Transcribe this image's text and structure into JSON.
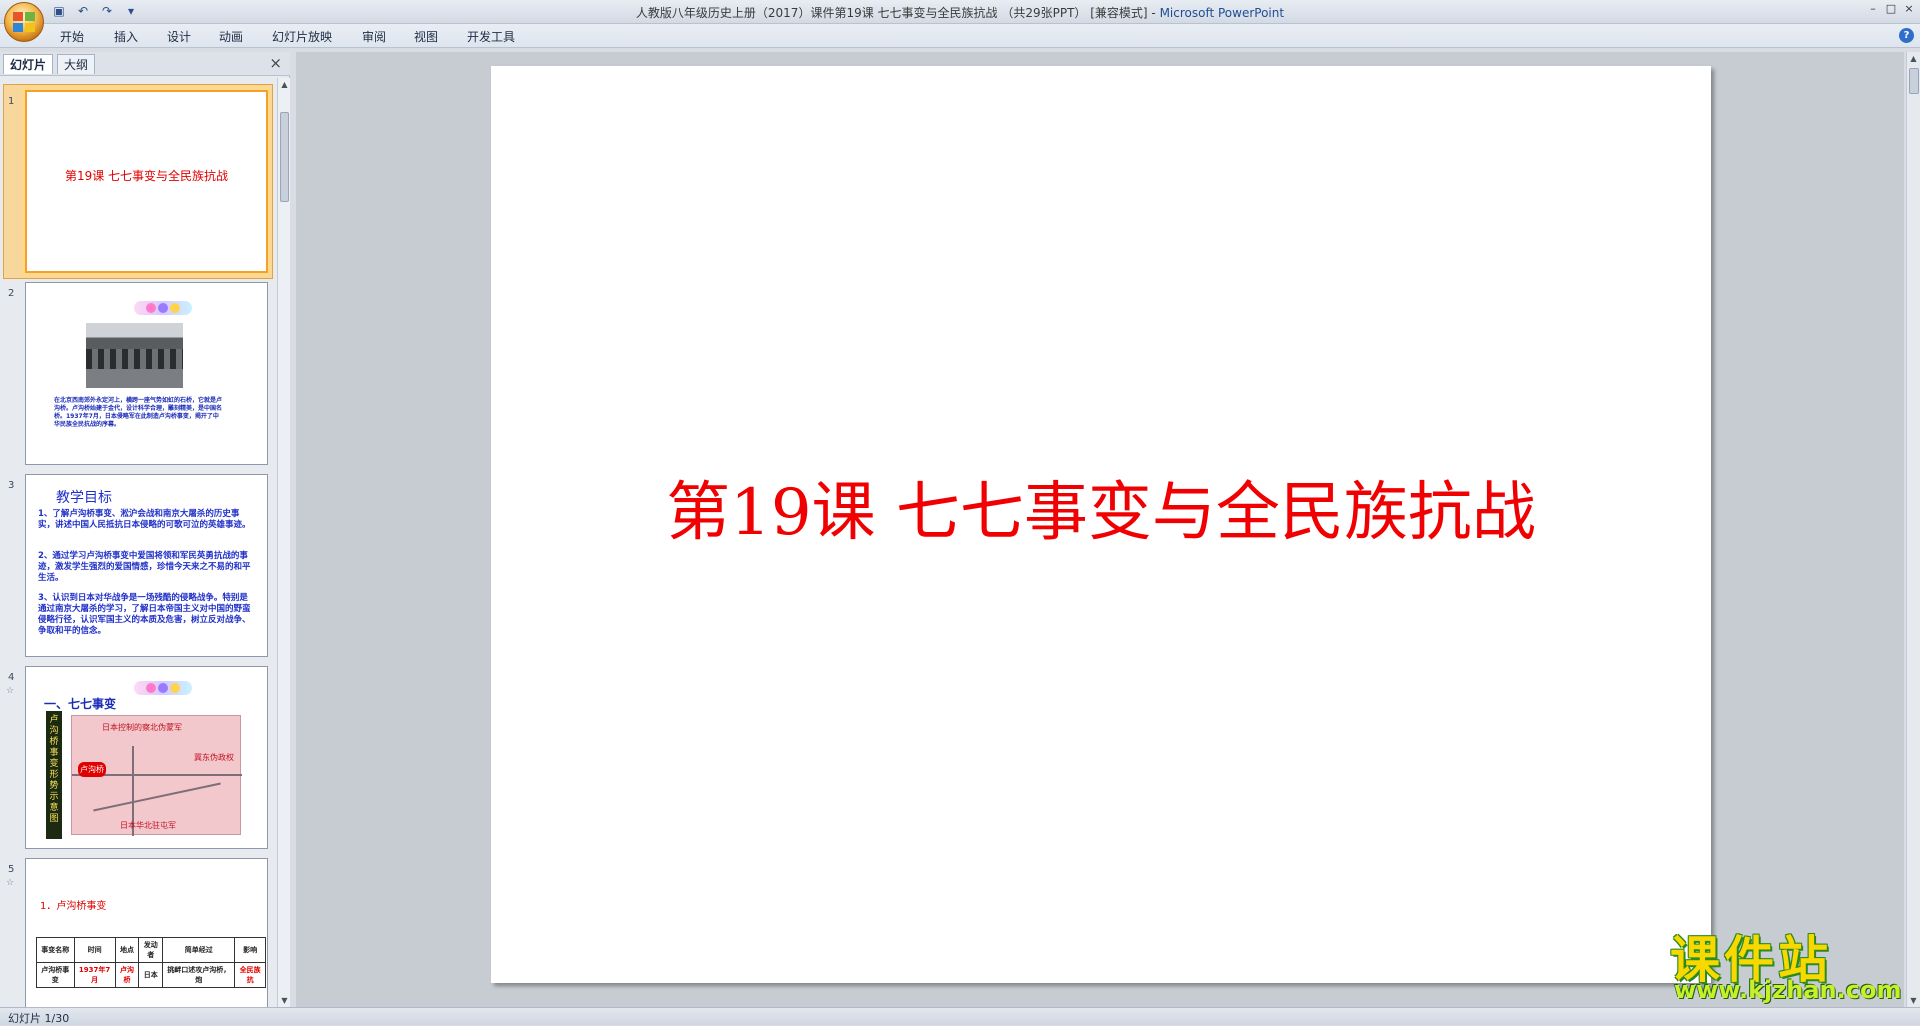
{
  "window": {
    "title": "人教版八年级历史上册（2017）课件第19课 七七事变与全民族抗战 （共29张PPT） [兼容模式]",
    "separator": " - ",
    "app": "Microsoft PowerPoint",
    "controls": [
      "–",
      "□",
      "×"
    ]
  },
  "qat": {
    "save_icon": "save-icon",
    "undo_icon": "undo-icon",
    "redo_icon": "redo-icon"
  },
  "ribbon": {
    "tabs": [
      "开始",
      "插入",
      "设计",
      "动画",
      "幻灯片放映",
      "审阅",
      "视图",
      "开发工具"
    ],
    "help": "?"
  },
  "left_pane": {
    "tabs": [
      "幻灯片",
      "大纲"
    ],
    "close": "×",
    "thumbnails": [
      {
        "number": "1",
        "title": "第19课  七七事变与全民族抗战"
      },
      {
        "number": "2",
        "text": "在北京西南郊外永定河上，横跨一座气势如虹的石桥，它就是卢沟桥。卢沟桥始建于金代，设计科学合理，雕刻精美，是中国名桥。1937年7月，日本侵略军在此制造卢沟桥事变，揭开了中华民族全民抗战的序幕。"
      },
      {
        "number": "3",
        "heading": "教学目标",
        "items": [
          "1、了解卢沟桥事变、淞沪会战和南京大屠杀的历史事实，讲述中国人民抵抗日本侵略的可歌可泣的英雄事迹。",
          "2、通过学习卢沟桥事变中爱国将领和军民英勇抗战的事迹，激发学生强烈的爱国情感，珍惜今天来之不易的和平生活。",
          "3、认识到日本对华战争是一场残酷的侵略战争。特别是通过南京大屠杀的学习，了解日本帝国主义对中国的野蛮侵略行径，认识军国主义的本质及危害，树立反对战争、争取和平的信念。"
        ]
      },
      {
        "number": "4",
        "sub": "☆",
        "heading": "一、七七事变",
        "bar_text": "卢沟桥事变形势示意图",
        "map_labels": [
          "日本控制的察北伪蒙军",
          "冀东伪政权",
          "日本华北驻屯军",
          "卢沟桥"
        ]
      },
      {
        "number": "5",
        "sub": "☆",
        "heading": "1．卢沟桥事变",
        "table_header": [
          "事变名称",
          "时间",
          "地点",
          "发动者",
          "简单经过",
          "影响"
        ],
        "table_row": [
          "卢沟桥事变",
          "1937年7月",
          "卢沟桥",
          "日本",
          "挑衅口述攻卢沟桥，炮",
          "全民族抗"
        ]
      }
    ]
  },
  "slide": {
    "title": "第19课  七七事变与全民族抗战"
  },
  "status": {
    "text": "幻灯片 1/30"
  },
  "watermark": {
    "title": "课件站",
    "url": "www.kjzhan.com"
  },
  "colors": {
    "slide_title": "#f00000",
    "selection": "#f4a12c",
    "accent_blue": "#2030c8"
  }
}
